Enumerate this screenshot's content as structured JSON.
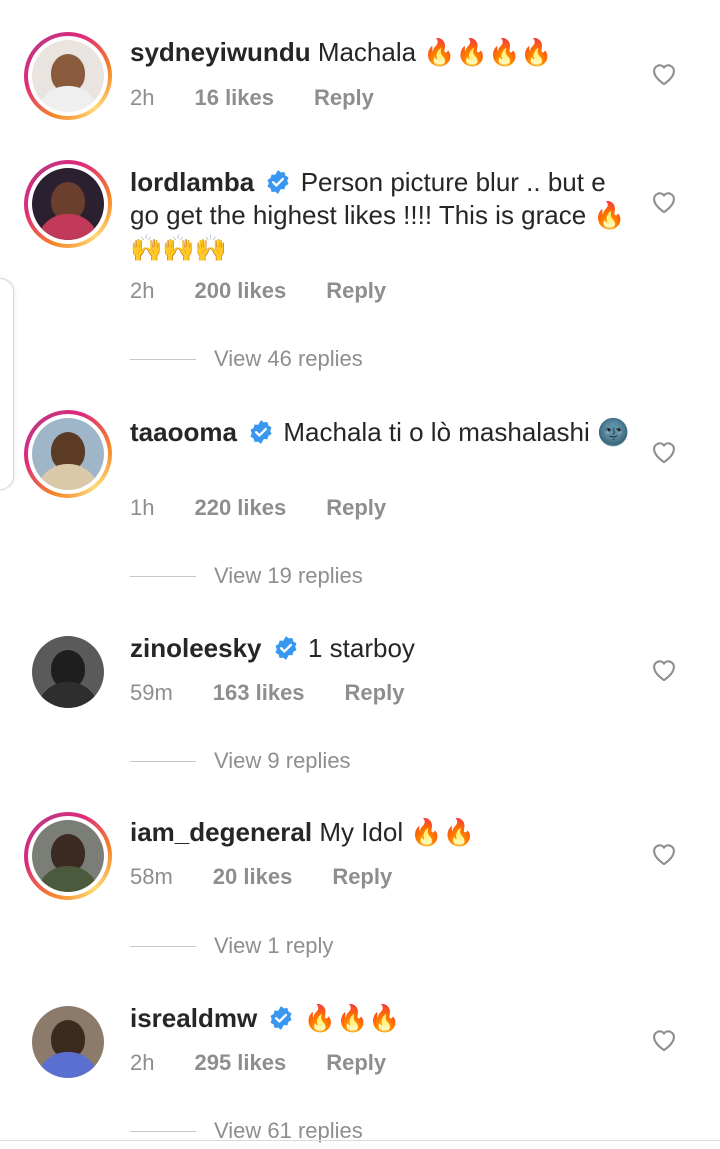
{
  "comments": [
    {
      "username": "sydneyiwundu",
      "verified": false,
      "text": "Machala 🔥🔥🔥🔥",
      "time": "2h",
      "likes": "16 likes",
      "reply": "Reply",
      "view_replies": ""
    },
    {
      "username": "lordlamba",
      "verified": true,
      "text": "Person picture blur .. but e go get the highest likes !!!! This is grace 🔥🙌🙌🙌",
      "time": "2h",
      "likes": "200 likes",
      "reply": "Reply",
      "view_replies": "View 46 replies"
    },
    {
      "username": "taaooma",
      "verified": true,
      "text": "Machala ti o lò mashalashi 🌚",
      "time": "1h",
      "likes": "220 likes",
      "reply": "Reply",
      "view_replies": "View 19 replies"
    },
    {
      "username": "zinoleesky",
      "verified": true,
      "text": "1 starboy",
      "time": "59m",
      "likes": "163 likes",
      "reply": "Reply",
      "view_replies": "View 9 replies"
    },
    {
      "username": "iam_degeneral",
      "verified": false,
      "text": "My Idol 🔥🔥",
      "time": "58m",
      "likes": "20 likes",
      "reply": "Reply",
      "view_replies": "View 1 reply"
    },
    {
      "username": "isrealdmw",
      "verified": true,
      "text": "🔥🔥🔥",
      "time": "2h",
      "likes": "295 likes",
      "reply": "Reply",
      "view_replies": "View 61 replies"
    }
  ],
  "colors": {
    "verified": "#3897f0",
    "meta": "#8e8e8e",
    "text": "#262626"
  },
  "icons": {
    "like": "heart-outline-icon",
    "verified": "verified-badge-icon"
  }
}
